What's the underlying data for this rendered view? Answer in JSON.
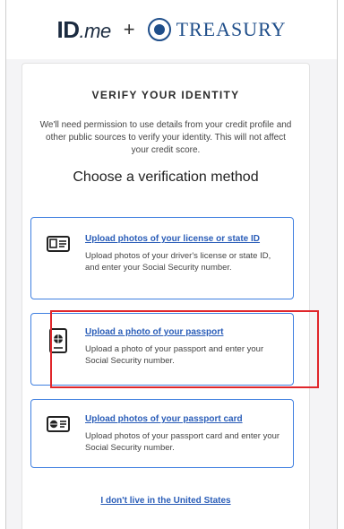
{
  "header": {
    "idme_logo": "ID.me",
    "plus": "+",
    "treasury_logo": "TREASURY"
  },
  "card": {
    "title": "VERIFY YOUR IDENTITY",
    "intro": "We'll need permission to use details from your credit profile and other public sources to verify your identity. This will not affect your credit score.",
    "choose_heading": "Choose a verification method"
  },
  "options": [
    {
      "icon": "id-card-icon",
      "label": "Upload photos of your license or state ID",
      "description": "Upload photos of your driver's license or state ID, and enter your Social Security number."
    },
    {
      "icon": "passport-icon",
      "label": "Upload a photo of your passport",
      "description": "Upload a photo of your passport and enter your Social Security number.",
      "highlighted": true
    },
    {
      "icon": "passport-card-icon",
      "label": "Upload photos of your passport card",
      "description": "Upload photos of your passport card and enter your Social Security number."
    }
  ],
  "footer_link": "I don't live in the United States",
  "colors": {
    "link": "#2a5db8",
    "option_border": "#3f7fe0",
    "highlight": "#e0262b",
    "treasury_blue": "#1f4e8a"
  }
}
